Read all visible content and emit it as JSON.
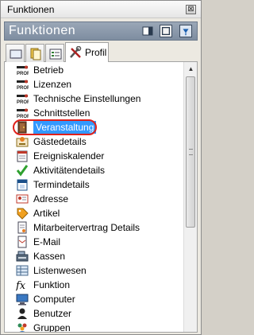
{
  "window": {
    "title": "Funktionen",
    "close_glyph": "⊠"
  },
  "panel": {
    "title": "Funktionen"
  },
  "tabs": [
    {
      "icon": "monitor-icon"
    },
    {
      "icon": "documents-icon"
    },
    {
      "icon": "form-icon"
    },
    {
      "icon": "tools-icon",
      "label": "Profil"
    }
  ],
  "items": [
    {
      "label": "Betrieb",
      "icon": "profil-key-icon"
    },
    {
      "label": "Lizenzen",
      "icon": "profil-key-icon"
    },
    {
      "label": "Technische Einstellungen",
      "icon": "profil-key-icon"
    },
    {
      "label": "Schnittstellen",
      "icon": "profil-key-icon"
    },
    {
      "label": "Veranstaltung",
      "icon": "event-door-icon",
      "selected": true
    },
    {
      "label": "Gästedetails",
      "icon": "guest-card-icon"
    },
    {
      "label": "Ereigniskalender",
      "icon": "calendar-icon"
    },
    {
      "label": "Aktivitätendetails",
      "icon": "checkmark-icon"
    },
    {
      "label": "Termindetails",
      "icon": "appointment-icon"
    },
    {
      "label": "Adresse",
      "icon": "address-card-icon"
    },
    {
      "label": "Artikel",
      "icon": "tag-icon"
    },
    {
      "label": "Mitarbeitervertrag Details",
      "icon": "contract-icon"
    },
    {
      "label": "E-Mail",
      "icon": "email-icon"
    },
    {
      "label": "Kassen",
      "icon": "cash-register-icon"
    },
    {
      "label": "Listenwesen",
      "icon": "list-icon"
    },
    {
      "label": "Funktion",
      "icon": "fx-icon"
    },
    {
      "label": "Computer",
      "icon": "computer-icon"
    },
    {
      "label": "Benutzer",
      "icon": "user-icon"
    },
    {
      "label": "Gruppen",
      "icon": "group-icon"
    }
  ],
  "colors": {
    "selection": "#3399ff",
    "highlight_ring": "#e0211b",
    "panel_header": "#8a98aa"
  }
}
